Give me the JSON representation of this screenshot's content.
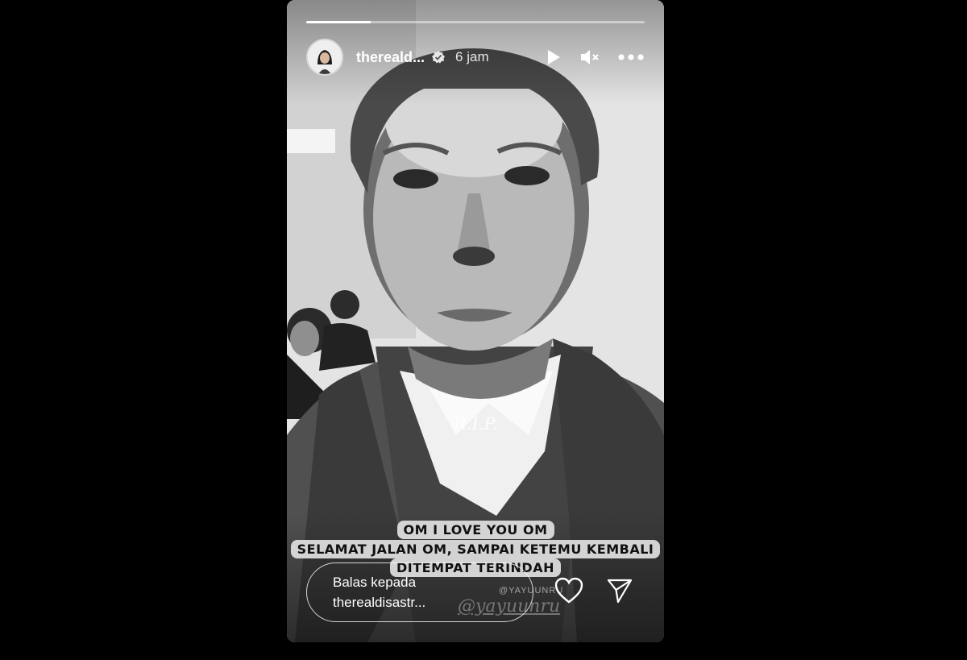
{
  "story": {
    "progress": 0.19,
    "username": "thereald...",
    "time": "6 jam",
    "controls": {
      "play_icon": "play-icon",
      "mute_icon": "volume-muted-icon",
      "more_icon": "more-horizontal-icon"
    },
    "overlay_text": "R.I.P.",
    "caption_lines": [
      "OM I LOVE YOU OM",
      "SELAMAT JALAN OM, SAMPAI KETEMU KEMBALI",
      "DITEMPAT TERINDAH"
    ],
    "watermark_handle": "@YAYUUNRU",
    "watermark_signature": "@yayuunru",
    "reply_line1": "Balas kepada",
    "reply_line2": "therealdisastr...",
    "actions": {
      "like_icon": "heart-icon",
      "share_icon": "send-icon"
    }
  },
  "colors": {
    "background": "#000000",
    "text": "#ffffff",
    "caption_bg": "#e1e1e1"
  }
}
